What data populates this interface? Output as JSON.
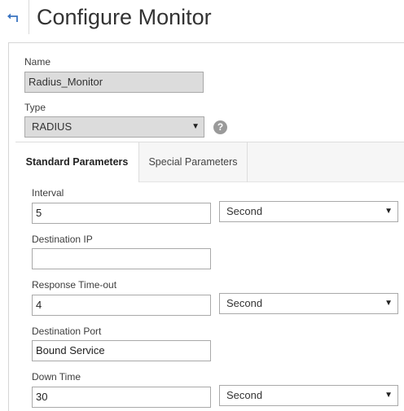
{
  "header": {
    "title": "Configure Monitor",
    "back_icon": "back-arrow-icon"
  },
  "form": {
    "name": {
      "label": "Name",
      "value": "Radius_Monitor"
    },
    "type": {
      "label": "Type",
      "value": "RADIUS",
      "help": "?"
    }
  },
  "tabs": [
    {
      "label": "Standard Parameters",
      "active": true
    },
    {
      "label": "Special Parameters",
      "active": false
    }
  ],
  "standard": {
    "interval": {
      "label": "Interval",
      "value": "5",
      "unit": "Second"
    },
    "destination_ip": {
      "label": "Destination IP",
      "value": ""
    },
    "response_timeout": {
      "label": "Response Time-out",
      "value": "4",
      "unit": "Second"
    },
    "destination_port": {
      "label": "Destination Port",
      "value": "Bound Service"
    },
    "down_time": {
      "label": "Down Time",
      "value": "30",
      "unit": "Second"
    }
  },
  "colors": {
    "accent": "#3a74c1",
    "readonly_bg": "#dcdcdc",
    "tabbar_bg": "#f6f6f6"
  }
}
